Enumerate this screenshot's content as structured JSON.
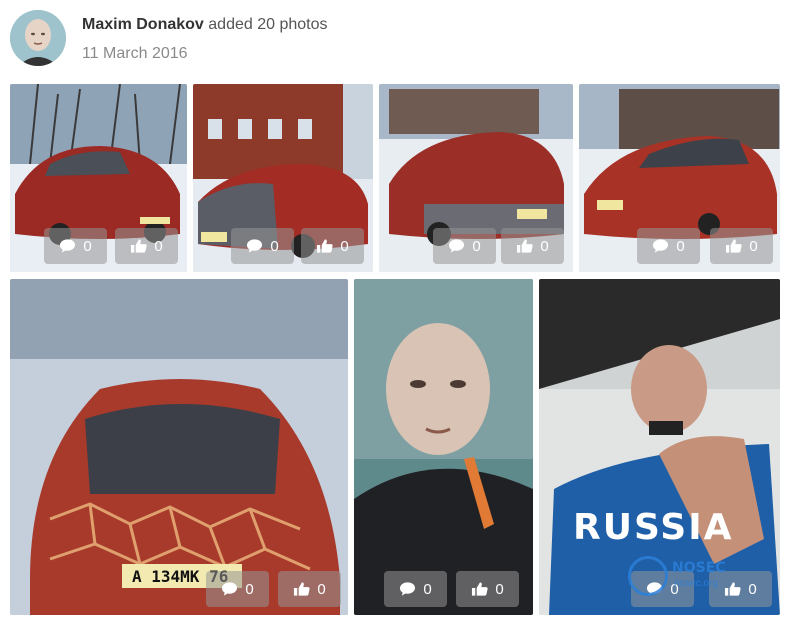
{
  "post": {
    "author": "Maxim Donakov",
    "action": "added 20 photos",
    "date": "11 March 2016"
  },
  "photos": [
    {
      "comments": "0",
      "likes": "0"
    },
    {
      "comments": "0",
      "likes": "0"
    },
    {
      "comments": "0",
      "likes": "0"
    },
    {
      "comments": "0",
      "likes": "0"
    },
    {
      "comments": "0",
      "likes": "0",
      "plate": "А 134МК 76"
    },
    {
      "comments": "0",
      "likes": "0"
    },
    {
      "comments": "0",
      "likes": "0",
      "shirt_text": "RUSSIA"
    }
  ],
  "watermark": {
    "text": "NOSEC",
    "sub": "nosec.org"
  },
  "icons": {
    "comment": "comment-icon",
    "like": "thumbs-up-icon"
  }
}
